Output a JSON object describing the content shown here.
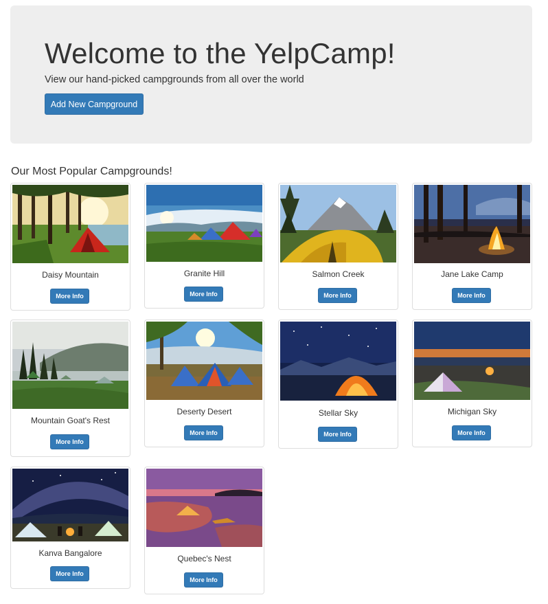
{
  "jumbotron": {
    "title": "Welcome to the YelpCamp!",
    "subtitle": "View our hand-picked campgrounds from all over the world",
    "add_button": "Add New Campground"
  },
  "section": {
    "heading": "Our Most Popular Campgrounds!"
  },
  "colors": {
    "primary": "#337ab7",
    "jumbotron_bg": "#eeeeee",
    "card_border": "#dddddd"
  },
  "campgrounds": [
    {
      "name": "Daisy Mountain",
      "button": "More Info",
      "image_icon": "forest-tent-sunrise-image"
    },
    {
      "name": "Granite Hill",
      "button": "More Info",
      "image_icon": "tents-on-meadow-image"
    },
    {
      "name": "Salmon Creek",
      "button": "More Info",
      "image_icon": "yellow-tent-mountain-image"
    },
    {
      "name": "Jane Lake Camp",
      "button": "More Info",
      "image_icon": "campfire-night-image"
    },
    {
      "name": "Mountain Goat's Rest",
      "button": "More Info",
      "image_icon": "lake-valley-tents-image"
    },
    {
      "name": "Deserty Desert",
      "button": "More Info",
      "image_icon": "colorful-tents-sunburst-image"
    },
    {
      "name": "Stellar Sky",
      "button": "More Info",
      "image_icon": "glowing-tent-starry-sky-image"
    },
    {
      "name": "Michigan Sky",
      "button": "More Info",
      "image_icon": "tent-dusk-shore-image"
    },
    {
      "name": "Kanva Bangalore",
      "button": "More Info",
      "image_icon": "milky-way-campers-image"
    },
    {
      "name": "Quebec's Nest",
      "button": "More Info",
      "image_icon": "lakeside-tent-sunset-image"
    }
  ]
}
